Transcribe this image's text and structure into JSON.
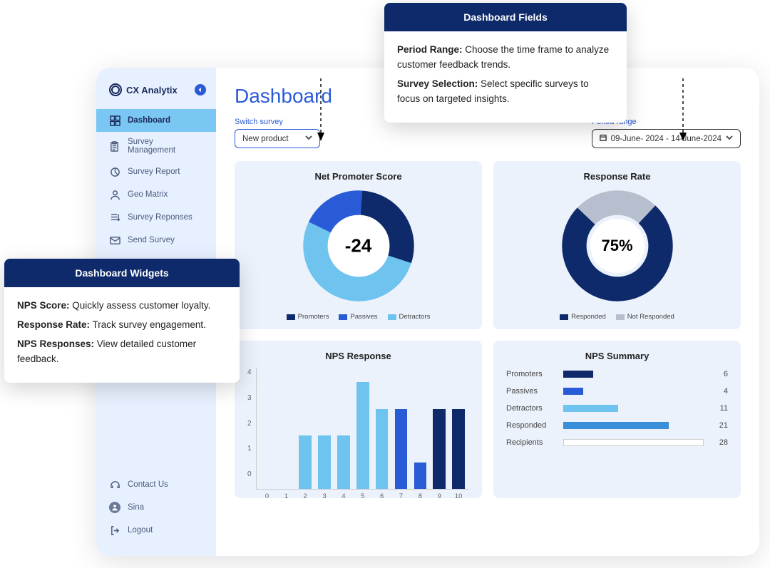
{
  "brand": "CX Analytix",
  "sidebar": {
    "items": [
      {
        "label": "Dashboard",
        "icon": "grid-icon",
        "active": true
      },
      {
        "label": "Survey Management",
        "icon": "clipboard-icon"
      },
      {
        "label": "Survey Report",
        "icon": "piechart-icon"
      },
      {
        "label": "Geo Matrix",
        "icon": "globe-user-icon"
      },
      {
        "label": "Survey Reponses",
        "icon": "list-arrow-icon"
      },
      {
        "label": "Send Survey",
        "icon": "mail-icon"
      }
    ],
    "bottom": [
      {
        "label": "Contact Us",
        "icon": "headset-icon"
      },
      {
        "label": "Sina",
        "icon": "avatar-icon"
      },
      {
        "label": "Logout",
        "icon": "logout-icon"
      }
    ]
  },
  "page": {
    "title": "Dashboard",
    "switch_label": "Switch survey",
    "survey_value": "New product",
    "period_label": "Period range",
    "period_value": "09-June- 2024  -  14-June-2024"
  },
  "widgets": {
    "nps": {
      "title": "Net Promoter Score",
      "center": "-24",
      "legend": [
        "Promoters",
        "Passives",
        "Detractors"
      ],
      "colors": {
        "promoters": "#0e2a6a",
        "passives": "#2a5bd7",
        "detractors": "#6ec3ef"
      }
    },
    "response_rate": {
      "title": "Response Rate",
      "center": "75%",
      "legend": [
        "Responded",
        "Not Responded"
      ],
      "colors": {
        "responded": "#0e2a6a",
        "not": "#b7bfcf"
      }
    },
    "nps_response": {
      "title": "NPS Response"
    },
    "nps_summary": {
      "title": "NPS Summary",
      "rows": [
        {
          "name": "Promoters",
          "value": 6
        },
        {
          "name": "Passives",
          "value": 4
        },
        {
          "name": "Detractors",
          "value": 11
        },
        {
          "name": "Responded",
          "value": 21
        },
        {
          "name": "Recipients",
          "value": 28
        }
      ]
    }
  },
  "callouts": {
    "fields": {
      "title": "Dashboard Fields",
      "lines": [
        {
          "bold": "Period Range:",
          "text": " Choose the time frame to analyze customer feedback trends."
        },
        {
          "bold": "Survey Selection:",
          "text": " Select specific surveys to focus on targeted insights."
        }
      ]
    },
    "widgets": {
      "title": "Dashboard Widgets",
      "lines": [
        {
          "bold": "NPS Score:",
          "text": " Quickly assess customer loyalty."
        },
        {
          "bold": "Response Rate:",
          "text": " Track survey engagement."
        },
        {
          "bold": "NPS Responses:",
          "text": " View detailed customer feedback."
        }
      ]
    }
  },
  "chart_data": [
    {
      "type": "pie",
      "title": "Net Promoter Score",
      "series": [
        {
          "name": "Promoters",
          "value": 29
        },
        {
          "name": "Passives",
          "value": 19
        },
        {
          "name": "Detractors",
          "value": 52
        }
      ],
      "center_label": "-24",
      "colors": [
        "#0e2a6a",
        "#2a5bd7",
        "#6ec3ef"
      ]
    },
    {
      "type": "pie",
      "title": "Response Rate",
      "series": [
        {
          "name": "Responded",
          "value": 75
        },
        {
          "name": "Not Responded",
          "value": 25
        }
      ],
      "center_label": "75%",
      "colors": [
        "#0e2a6a",
        "#b7bfcf"
      ]
    },
    {
      "type": "bar",
      "title": "NPS Response",
      "categories": [
        0,
        1,
        2,
        3,
        4,
        5,
        6,
        7,
        8,
        9,
        10
      ],
      "values": [
        0,
        0,
        2,
        2,
        2,
        4,
        3,
        3,
        1,
        3,
        3
      ],
      "ylim": [
        0,
        4
      ],
      "yticks": [
        0,
        1,
        2,
        3,
        4
      ],
      "colors": [
        "#6ec3ef",
        "#6ec3ef",
        "#6ec3ef",
        "#6ec3ef",
        "#6ec3ef",
        "#6ec3ef",
        "#6ec3ef",
        "#2a5bd7",
        "#2a5bd7",
        "#0e2a6a",
        "#0e2a6a"
      ]
    },
    {
      "type": "bar",
      "title": "NPS Summary",
      "orientation": "horizontal",
      "categories": [
        "Promoters",
        "Passives",
        "Detractors",
        "Responded",
        "Recipients"
      ],
      "values": [
        6,
        4,
        11,
        21,
        28
      ],
      "xlim": [
        0,
        28
      ],
      "colors": [
        "#0e2a6a",
        "#2a5bd7",
        "#6ec3ef",
        "#3a8fd9",
        "#ffffff"
      ]
    }
  ]
}
